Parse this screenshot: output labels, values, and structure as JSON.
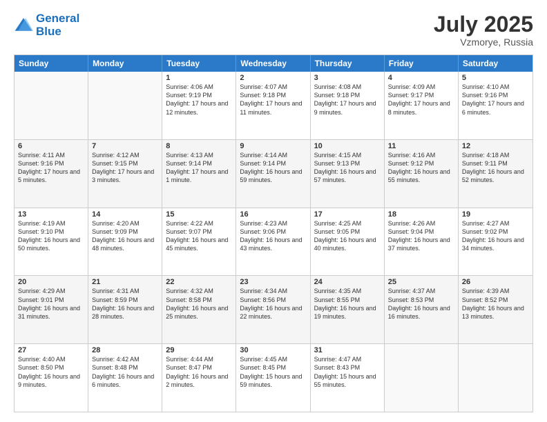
{
  "logo": {
    "line1": "General",
    "line2": "Blue"
  },
  "title": "July 2025",
  "location": "Vzmorye, Russia",
  "days_of_week": [
    "Sunday",
    "Monday",
    "Tuesday",
    "Wednesday",
    "Thursday",
    "Friday",
    "Saturday"
  ],
  "weeks": [
    [
      {
        "day": "",
        "info": ""
      },
      {
        "day": "",
        "info": ""
      },
      {
        "day": "1",
        "info": "Sunrise: 4:06 AM\nSunset: 9:19 PM\nDaylight: 17 hours and 12 minutes."
      },
      {
        "day": "2",
        "info": "Sunrise: 4:07 AM\nSunset: 9:18 PM\nDaylight: 17 hours and 11 minutes."
      },
      {
        "day": "3",
        "info": "Sunrise: 4:08 AM\nSunset: 9:18 PM\nDaylight: 17 hours and 9 minutes."
      },
      {
        "day": "4",
        "info": "Sunrise: 4:09 AM\nSunset: 9:17 PM\nDaylight: 17 hours and 8 minutes."
      },
      {
        "day": "5",
        "info": "Sunrise: 4:10 AM\nSunset: 9:16 PM\nDaylight: 17 hours and 6 minutes."
      }
    ],
    [
      {
        "day": "6",
        "info": "Sunrise: 4:11 AM\nSunset: 9:16 PM\nDaylight: 17 hours and 5 minutes."
      },
      {
        "day": "7",
        "info": "Sunrise: 4:12 AM\nSunset: 9:15 PM\nDaylight: 17 hours and 3 minutes."
      },
      {
        "day": "8",
        "info": "Sunrise: 4:13 AM\nSunset: 9:14 PM\nDaylight: 17 hours and 1 minute."
      },
      {
        "day": "9",
        "info": "Sunrise: 4:14 AM\nSunset: 9:14 PM\nDaylight: 16 hours and 59 minutes."
      },
      {
        "day": "10",
        "info": "Sunrise: 4:15 AM\nSunset: 9:13 PM\nDaylight: 16 hours and 57 minutes."
      },
      {
        "day": "11",
        "info": "Sunrise: 4:16 AM\nSunset: 9:12 PM\nDaylight: 16 hours and 55 minutes."
      },
      {
        "day": "12",
        "info": "Sunrise: 4:18 AM\nSunset: 9:11 PM\nDaylight: 16 hours and 52 minutes."
      }
    ],
    [
      {
        "day": "13",
        "info": "Sunrise: 4:19 AM\nSunset: 9:10 PM\nDaylight: 16 hours and 50 minutes."
      },
      {
        "day": "14",
        "info": "Sunrise: 4:20 AM\nSunset: 9:09 PM\nDaylight: 16 hours and 48 minutes."
      },
      {
        "day": "15",
        "info": "Sunrise: 4:22 AM\nSunset: 9:07 PM\nDaylight: 16 hours and 45 minutes."
      },
      {
        "day": "16",
        "info": "Sunrise: 4:23 AM\nSunset: 9:06 PM\nDaylight: 16 hours and 43 minutes."
      },
      {
        "day": "17",
        "info": "Sunrise: 4:25 AM\nSunset: 9:05 PM\nDaylight: 16 hours and 40 minutes."
      },
      {
        "day": "18",
        "info": "Sunrise: 4:26 AM\nSunset: 9:04 PM\nDaylight: 16 hours and 37 minutes."
      },
      {
        "day": "19",
        "info": "Sunrise: 4:27 AM\nSunset: 9:02 PM\nDaylight: 16 hours and 34 minutes."
      }
    ],
    [
      {
        "day": "20",
        "info": "Sunrise: 4:29 AM\nSunset: 9:01 PM\nDaylight: 16 hours and 31 minutes."
      },
      {
        "day": "21",
        "info": "Sunrise: 4:31 AM\nSunset: 8:59 PM\nDaylight: 16 hours and 28 minutes."
      },
      {
        "day": "22",
        "info": "Sunrise: 4:32 AM\nSunset: 8:58 PM\nDaylight: 16 hours and 25 minutes."
      },
      {
        "day": "23",
        "info": "Sunrise: 4:34 AM\nSunset: 8:56 PM\nDaylight: 16 hours and 22 minutes."
      },
      {
        "day": "24",
        "info": "Sunrise: 4:35 AM\nSunset: 8:55 PM\nDaylight: 16 hours and 19 minutes."
      },
      {
        "day": "25",
        "info": "Sunrise: 4:37 AM\nSunset: 8:53 PM\nDaylight: 16 hours and 16 minutes."
      },
      {
        "day": "26",
        "info": "Sunrise: 4:39 AM\nSunset: 8:52 PM\nDaylight: 16 hours and 13 minutes."
      }
    ],
    [
      {
        "day": "27",
        "info": "Sunrise: 4:40 AM\nSunset: 8:50 PM\nDaylight: 16 hours and 9 minutes."
      },
      {
        "day": "28",
        "info": "Sunrise: 4:42 AM\nSunset: 8:48 PM\nDaylight: 16 hours and 6 minutes."
      },
      {
        "day": "29",
        "info": "Sunrise: 4:44 AM\nSunset: 8:47 PM\nDaylight: 16 hours and 2 minutes."
      },
      {
        "day": "30",
        "info": "Sunrise: 4:45 AM\nSunset: 8:45 PM\nDaylight: 15 hours and 59 minutes."
      },
      {
        "day": "31",
        "info": "Sunrise: 4:47 AM\nSunset: 8:43 PM\nDaylight: 15 hours and 55 minutes."
      },
      {
        "day": "",
        "info": ""
      },
      {
        "day": "",
        "info": ""
      }
    ]
  ]
}
